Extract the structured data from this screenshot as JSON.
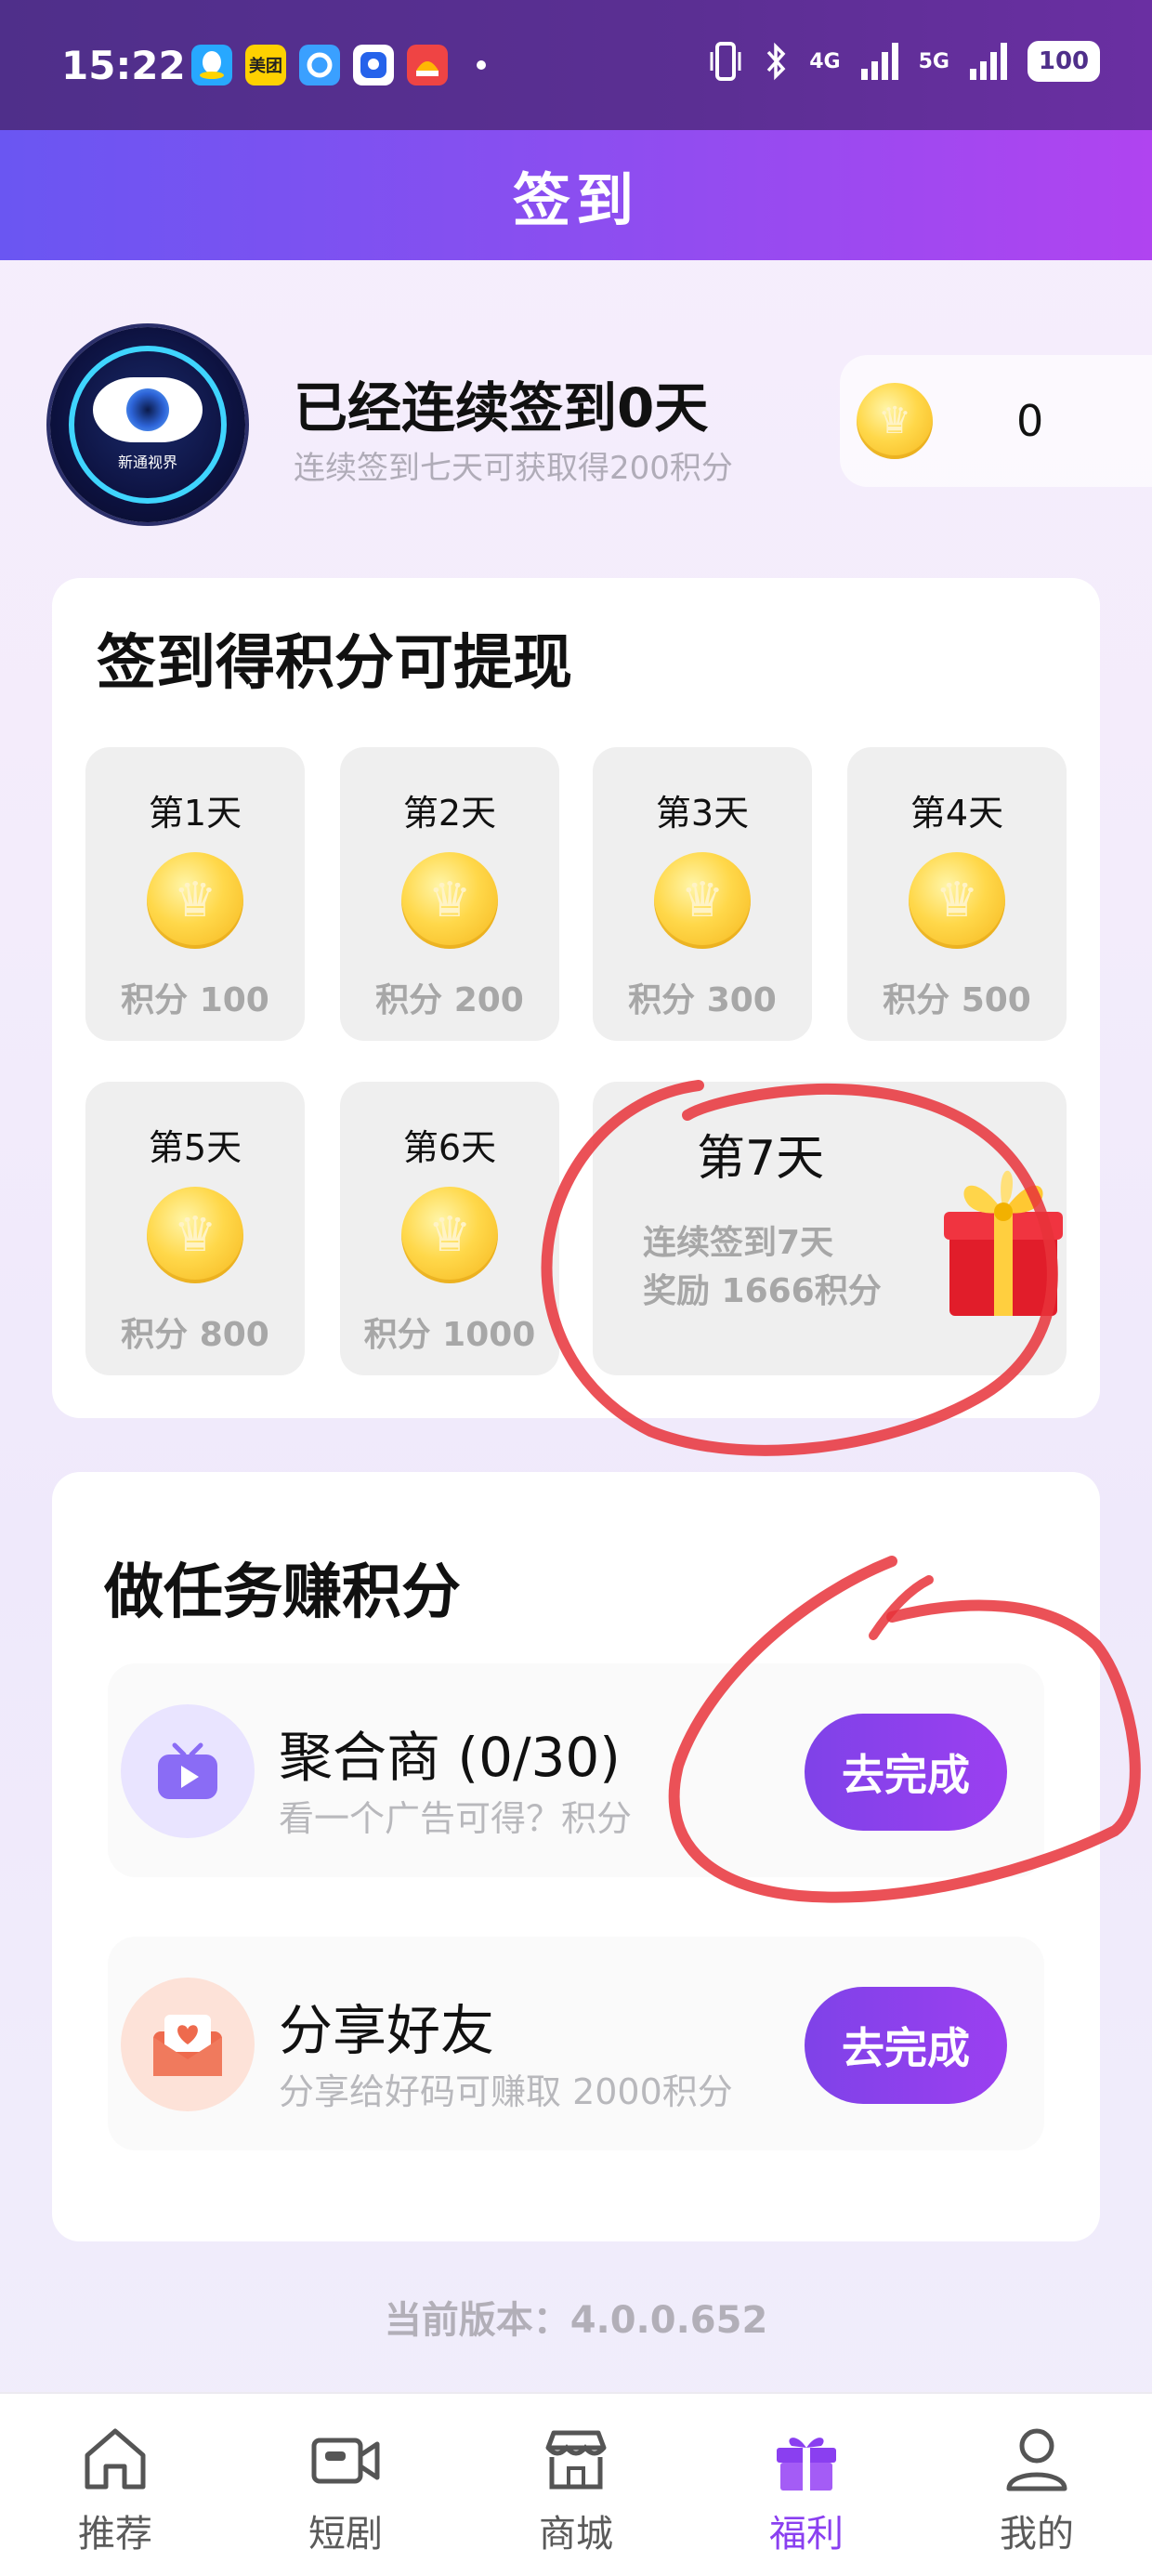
{
  "status_bar": {
    "time": "15:22",
    "apps": [
      {
        "icon": "qq-icon",
        "label": "",
        "color": "#27a8ff"
      },
      {
        "icon": "meituan-icon",
        "label": "美团",
        "color": "#ffd100"
      },
      {
        "icon": "browser-icon",
        "label": "",
        "color": "#3aa0ff"
      },
      {
        "icon": "app-icon",
        "label": "",
        "color": "#2563eb"
      },
      {
        "icon": "game-icon",
        "label": "",
        "color": "#ef4444"
      }
    ],
    "network_1": "4G",
    "network_2": "5G",
    "battery": "100"
  },
  "header": {
    "title": "签到"
  },
  "summary": {
    "avatar_text": "新通视界",
    "title": "已经连续签到0天",
    "subtitle": "连续签到七天可获取得200积分",
    "points": "0"
  },
  "checkin": {
    "title": "签到得积分可提现",
    "days": [
      {
        "label": "第1天",
        "points": "积分 100"
      },
      {
        "label": "第2天",
        "points": "积分 200"
      },
      {
        "label": "第3天",
        "points": "积分 300"
      },
      {
        "label": "第4天",
        "points": "积分 500"
      },
      {
        "label": "第5天",
        "points": "积分 800"
      },
      {
        "label": "第6天",
        "points": "积分 1000"
      }
    ],
    "day7": {
      "label": "第7天",
      "desc_line1": "连续签到7天",
      "desc_line2": "奖励 1666积分"
    }
  },
  "tasks": {
    "title": "做任务赚积分",
    "items": [
      {
        "name": "聚合商 (0/30)",
        "desc": "看一个广告可得？积分",
        "button": "去完成",
        "icon": "video-tv-icon"
      },
      {
        "name": "分享好友",
        "desc": "分享给好码可赚取 2000积分",
        "button": "去完成",
        "icon": "share-heart-icon"
      }
    ]
  },
  "version": "当前版本：4.0.0.652",
  "bottom_nav": {
    "items": [
      {
        "label": "推荐",
        "icon": "home-icon"
      },
      {
        "label": "短剧",
        "icon": "video-camera-icon"
      },
      {
        "label": "商城",
        "icon": "shop-icon"
      },
      {
        "label": "福利",
        "icon": "gift-icon",
        "active": true
      },
      {
        "label": "我的",
        "icon": "user-icon"
      }
    ]
  },
  "colors": {
    "accent": "#8a3ff0",
    "header_start": "#6a56f2",
    "header_end": "#b044f0",
    "annotation_red": "#e8333a"
  }
}
